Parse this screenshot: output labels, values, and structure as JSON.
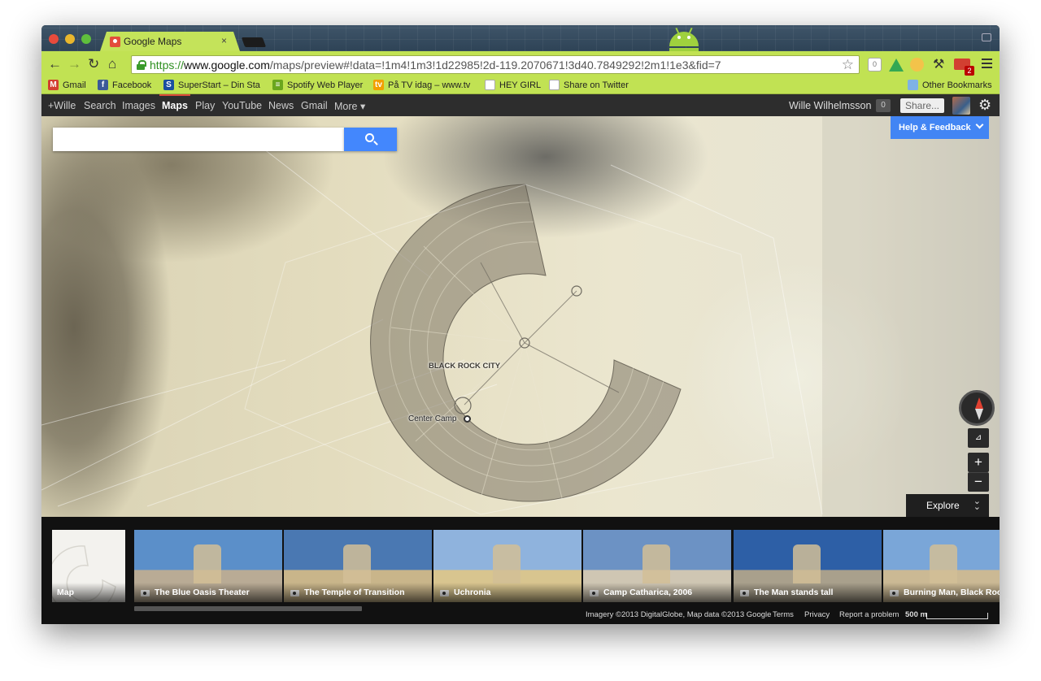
{
  "browser": {
    "tab_title": "Google Maps",
    "tab_close": "×",
    "url_scheme": "https://",
    "url_host": "www.google.com",
    "url_path": "/maps/preview#!data=!1m4!1m3!1d22985!2d-119.2070671!3d40.7849292!2m1!1e3&fid=7",
    "ext_count": "0",
    "mail_badge": "2",
    "bookmarks": [
      {
        "label": "Gmail",
        "icon": "gmail-icon",
        "color": "#d23f31",
        "glyph": "M"
      },
      {
        "label": "Facebook",
        "icon": "facebook-icon",
        "color": "#3b5998",
        "glyph": "f"
      },
      {
        "label": "SuperStart – Din Sta",
        "icon": "superstart-icon",
        "color": "#1a4fa0",
        "glyph": "S"
      },
      {
        "label": "Spotify Web Player",
        "icon": "spotify-icon",
        "color": "#6aa61e",
        "glyph": "≡"
      },
      {
        "label": "På TV idag – www.tv",
        "icon": "tv-icon",
        "color": "#f2a000",
        "glyph": "tv"
      },
      {
        "label": "HEY GIRL",
        "icon": "page-icon",
        "color": "#ffffff",
        "glyph": ""
      },
      {
        "label": "Share on Twitter",
        "icon": "page-icon",
        "color": "#ffffff",
        "glyph": ""
      }
    ],
    "other_bookmarks": "Other Bookmarks"
  },
  "google_bar": {
    "items": [
      "+Wille",
      "Search",
      "Images",
      "Maps",
      "Play",
      "YouTube",
      "News",
      "Gmail",
      "More ▾"
    ],
    "active": "Maps",
    "user_name": "Wille Wilhelmsson",
    "notification_count": "0",
    "share_label": "Share..."
  },
  "map": {
    "search_placeholder": "",
    "help_label": "Help & Feedback",
    "city_label": "BLACK ROCK CITY",
    "poi_label": "Center Camp",
    "tilt_label": "⊿",
    "zoom_in": "+",
    "zoom_out": "−",
    "explore_label": "Explore"
  },
  "strip": {
    "map_label": "Map",
    "photos": [
      {
        "label": "The Blue Oasis Theater",
        "sky": "#5b8fc9",
        "ground": "#b9ab95"
      },
      {
        "label": "The Temple of Transition",
        "sky": "#4a78b2",
        "ground": "#c9b58a"
      },
      {
        "label": "Uchronia",
        "sky": "#8fb3dd",
        "ground": "#d8c58f"
      },
      {
        "label": "Camp Catharica, 2006",
        "sky": "#6c92c4",
        "ground": "#cfc6b3"
      },
      {
        "label": "The Man stands tall",
        "sky": "#2d5fa6",
        "ground": "#a9a08c"
      },
      {
        "label": "Burning Man, Black Rock C",
        "sky": "#7aa6d8",
        "ground": "#cbb994"
      }
    ],
    "footer": {
      "imagery": "Imagery ©2013 DigitalGlobe, Map data ©2013 Google",
      "terms": "Terms",
      "privacy": "Privacy",
      "report": "Report a problem",
      "scale": "500 m"
    }
  }
}
